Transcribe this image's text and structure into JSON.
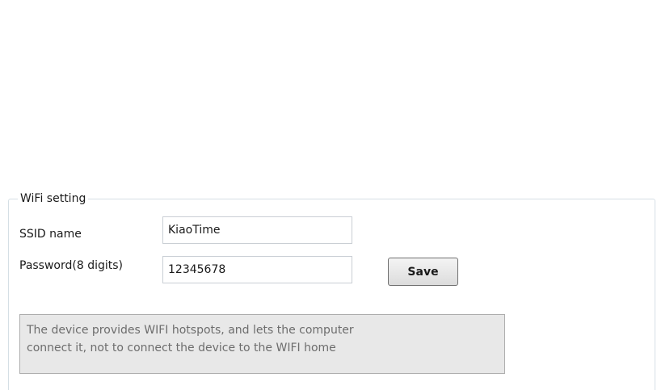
{
  "wifi_setting": {
    "group_title": "WiFi setting",
    "ssid": {
      "label": "SSID name",
      "value": "KiaoTime"
    },
    "password": {
      "label": "Password(8 digits)",
      "value": "12345678"
    },
    "save_label": "Save",
    "info_lines": [
      "The device provides WIFI hotspots, and lets the computer",
      "connect it, not to connect the device to the WIFI home"
    ]
  }
}
